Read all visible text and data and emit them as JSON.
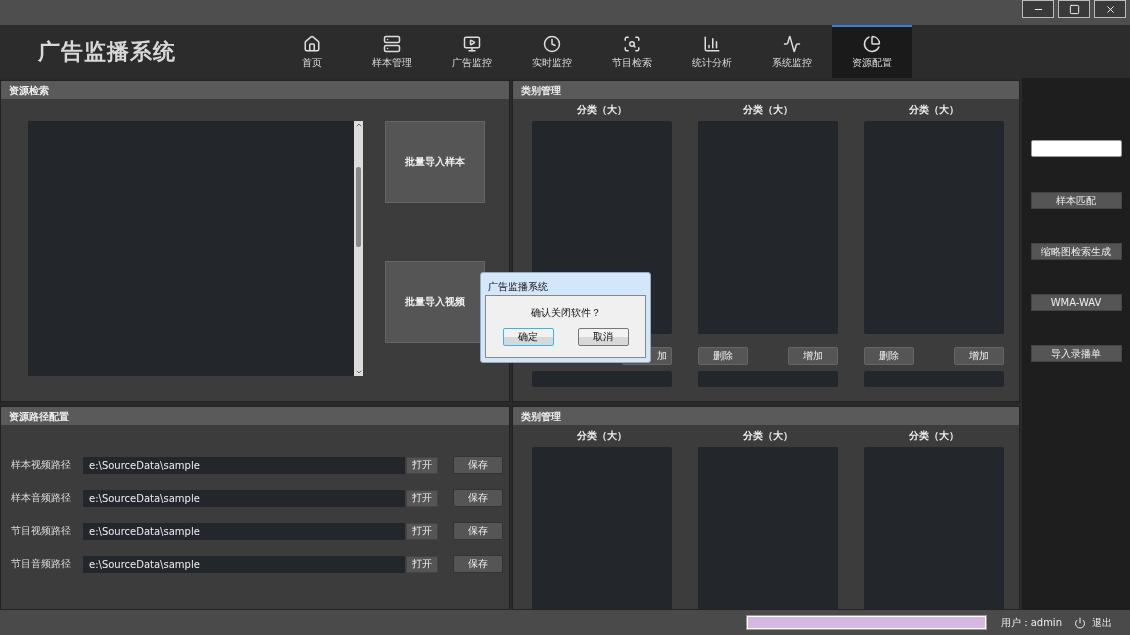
{
  "header": {
    "logo": "广告监播系统",
    "nav": [
      {
        "label": "首页",
        "selected": false
      },
      {
        "label": "样本管理",
        "selected": false
      },
      {
        "label": "广告监控",
        "selected": false
      },
      {
        "label": "实时监控",
        "selected": false
      },
      {
        "label": "节目检索",
        "selected": false
      },
      {
        "label": "统计分析",
        "selected": false
      },
      {
        "label": "系统监控",
        "selected": false
      },
      {
        "label": "资源配置",
        "selected": true
      }
    ]
  },
  "resource_search": {
    "title": "资源检索",
    "buttons": [
      "批量导入样本",
      "批量导入视频"
    ]
  },
  "category_top": {
    "title": "类别管理",
    "columns": [
      {
        "heading": "分类（大）",
        "buttons": [
          {
            "kind": "add",
            "label": "加"
          }
        ]
      },
      {
        "heading": "分类（大）",
        "buttons": [
          {
            "kind": "delete",
            "label": "删除"
          },
          {
            "kind": "add",
            "label": "增加"
          }
        ]
      },
      {
        "heading": "分类（大）",
        "buttons": [
          {
            "kind": "delete",
            "label": "删除"
          },
          {
            "kind": "add",
            "label": "增加"
          }
        ]
      }
    ]
  },
  "path_config": {
    "title": "资源路径配置",
    "rows": [
      {
        "label": "样本视频路径",
        "value": "e:\\SourceData\\sample",
        "open": "打开",
        "save": "保存"
      },
      {
        "label": "样本音频路径",
        "value": "e:\\SourceData\\sample",
        "open": "打开",
        "save": "保存"
      },
      {
        "label": "节目视频路径",
        "value": "e:\\SourceData\\sample",
        "open": "打开",
        "save": "保存"
      },
      {
        "label": "节目音频路径",
        "value": "e:\\SourceData\\sample",
        "open": "打开",
        "save": "保存"
      }
    ]
  },
  "category_bottom": {
    "title": "类别管理",
    "columns": [
      {
        "heading": "分类（大）"
      },
      {
        "heading": "分类（大）"
      },
      {
        "heading": "分类（大）"
      }
    ]
  },
  "sidebar": {
    "buttons": [
      "样本匹配",
      "缩略图检索生成",
      "WMA-WAV",
      "导入录播单"
    ]
  },
  "dialog": {
    "title": "广告监播系统",
    "message": "确认关闭软件？",
    "buttons": [
      {
        "label": "确定",
        "focused": true
      },
      {
        "label": "取消",
        "focused": false
      }
    ]
  },
  "status_bar": {
    "progress": {
      "level": 1
    },
    "user": "用户：admin",
    "logout": "退出"
  }
}
